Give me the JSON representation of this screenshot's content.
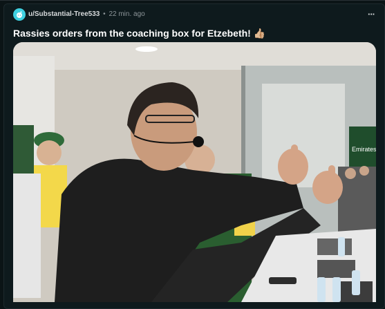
{
  "post": {
    "subreddit": "u/Substantial-Tree533",
    "separator": "•",
    "time_ago": "22 min. ago",
    "more_label": "···",
    "title": "Rassies orders from the coaching box for Etzebeth!",
    "title_emoji": "👍🏼"
  },
  "media": {
    "type": "video-frame",
    "sign_text": "Emirates"
  },
  "colors": {
    "background": "#0b1416",
    "avatar": "#3fd0e0",
    "meta_text": "#8d9599"
  },
  "icons": {
    "avatar": "reddit-avatar-icon",
    "more": "more-options-icon"
  }
}
